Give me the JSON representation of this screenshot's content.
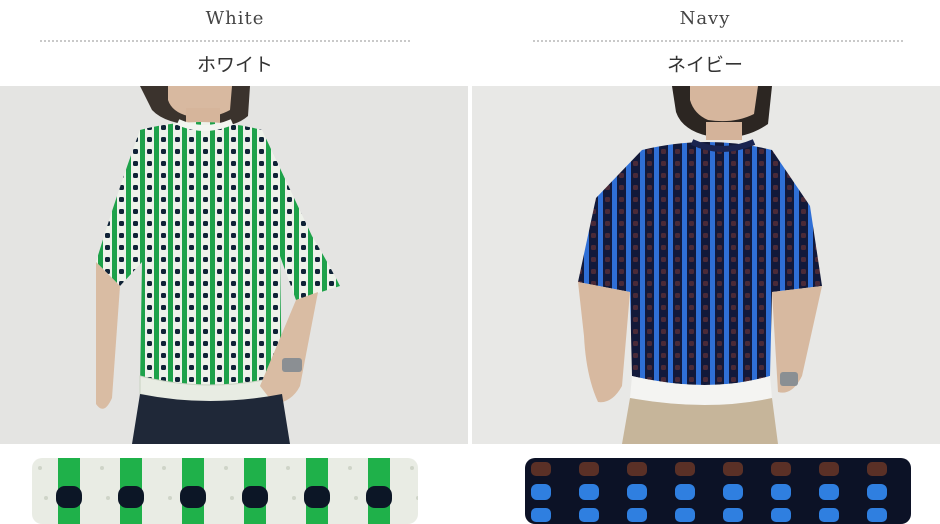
{
  "products": [
    {
      "color_en": "White",
      "color_jp": "ホワイト",
      "icon": "model-photo-white-knit-tee",
      "swatch_icon": "fabric-swatch-white-green-knit",
      "colors": {
        "base": "#f1f3ee",
        "stripe": "#17a043",
        "dot": "#0d1b2e"
      }
    },
    {
      "color_en": "Navy",
      "color_jp": "ネイビー",
      "icon": "model-photo-navy-knit-tee",
      "swatch_icon": "fabric-swatch-navy-blue-brown-knit",
      "colors": {
        "base": "#0f1630",
        "stripe": "#2f6fd6",
        "dot": "#5a2f28"
      }
    }
  ]
}
